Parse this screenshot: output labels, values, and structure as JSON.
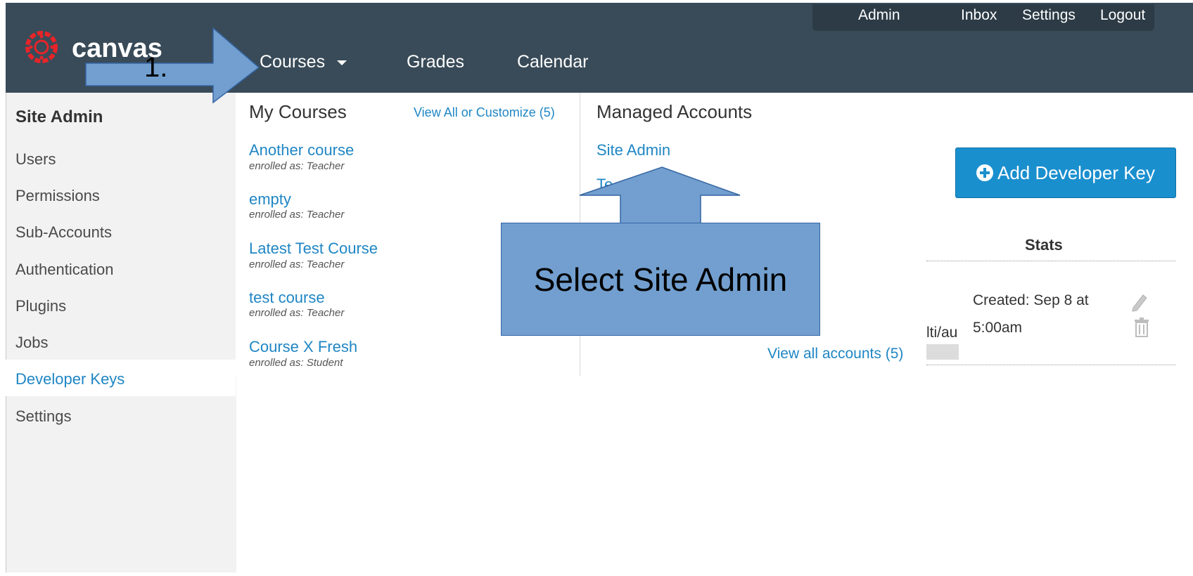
{
  "header": {
    "logo_text": "canvas",
    "user_bar": {
      "admin": "Admin",
      "inbox": "Inbox",
      "settings": "Settings",
      "logout": "Logout"
    },
    "nav": {
      "courses": "Courses",
      "grades": "Grades",
      "calendar": "Calendar"
    }
  },
  "sidebar": {
    "title": "Site Admin",
    "items": [
      {
        "label": "Users"
      },
      {
        "label": "Permissions"
      },
      {
        "label": "Sub-Accounts"
      },
      {
        "label": "Authentication"
      },
      {
        "label": "Plugins"
      },
      {
        "label": "Jobs"
      },
      {
        "label": "Developer Keys",
        "active": true
      },
      {
        "label": "Settings"
      }
    ]
  },
  "dropdown": {
    "my_courses": {
      "heading": "My Courses",
      "view_all": "View All or Customize (5)",
      "courses": [
        {
          "name": "Another course",
          "enrolled": "enrolled as: Teacher"
        },
        {
          "name": "empty",
          "enrolled": "enrolled as: Teacher"
        },
        {
          "name": "Latest Test Course",
          "enrolled": "enrolled as: Teacher"
        },
        {
          "name": "test course",
          "enrolled": "enrolled as: Teacher"
        },
        {
          "name": "Course X Fresh",
          "enrolled": "enrolled as: Student"
        }
      ]
    },
    "managed_accounts": {
      "heading": "Managed Accounts",
      "accounts": [
        {
          "name": "Site Admin"
        },
        {
          "name": "Te"
        }
      ],
      "view_all": "View all accounts (5)"
    }
  },
  "content": {
    "add_key_button": "Add Developer Key",
    "stats_header": "Stats",
    "partial_cell": "lti/au",
    "created_line1": "Created: Sep 8 at",
    "created_line2": "5:00am"
  },
  "annotations": {
    "step_label": "1.",
    "callout": "Select Site Admin",
    "arrow_color": "#729fcf"
  },
  "colors": {
    "header_bg": "#394b58",
    "link": "#1f86c4",
    "button": "#1a8fce"
  }
}
